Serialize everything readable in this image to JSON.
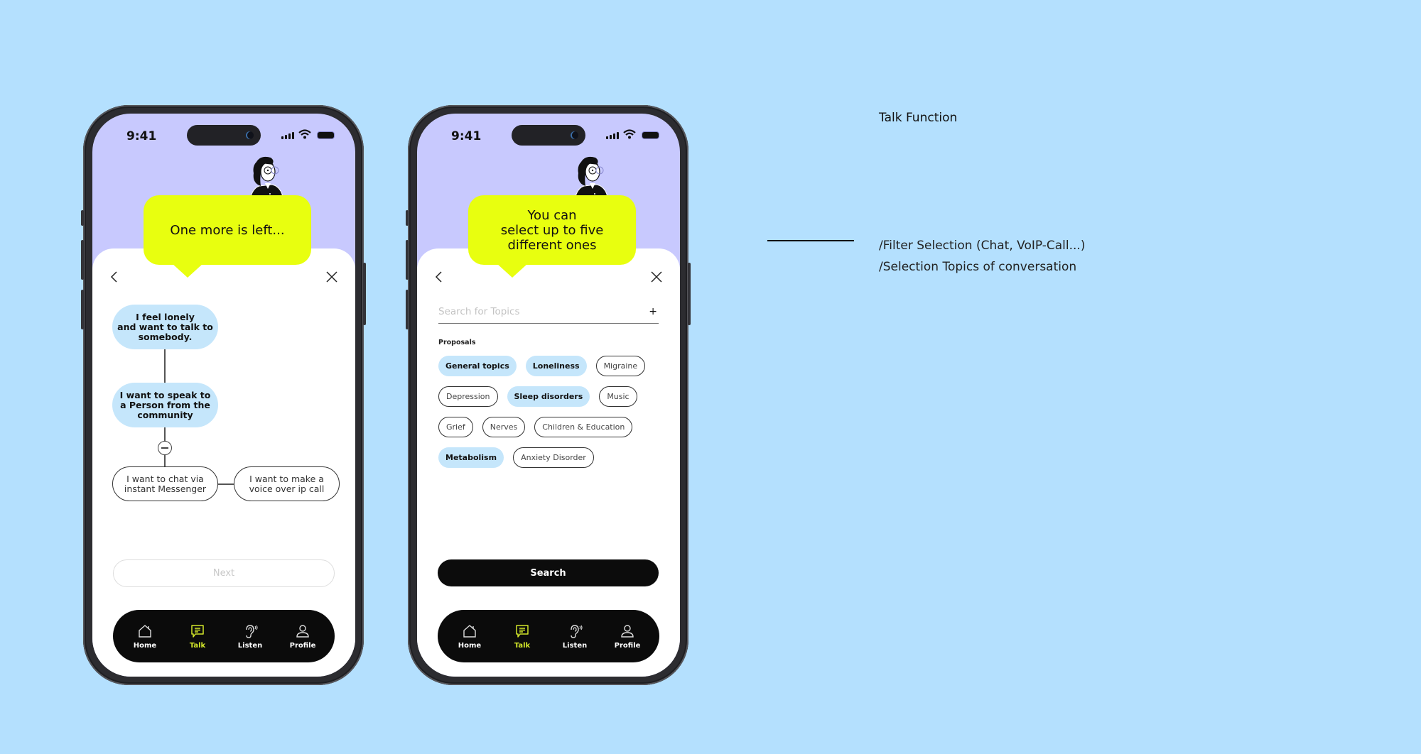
{
  "annotation": {
    "title": "Talk Function",
    "items": [
      "/Filter Selection (Chat, VoIP-Call...)",
      "/Selection Topics of conversation"
    ]
  },
  "colors": {
    "background": "#b4e0fe",
    "header_lavender": "#c8c9fe",
    "bubble_yellow": "#e8ff0f",
    "chip_selected": "#c5e6fb",
    "tab_active": "#d2e62a"
  },
  "phones": [
    {
      "status": {
        "time": "9:41"
      },
      "bubble_text": "One more is left...",
      "flow": {
        "node1": "I feel lonely\nand want to talk to\nsomebody.",
        "node2": "I want to speak to\na  Person from the\ncommunity",
        "option_chat": "I want to chat via\ninstant Messenger",
        "option_voip": "I want to make a\nvoice over ip call"
      },
      "next_label": "Next",
      "tabs": [
        {
          "label": "Home",
          "icon": "home-icon"
        },
        {
          "label": "Talk",
          "icon": "chat-icon",
          "active": true
        },
        {
          "label": "Listen",
          "icon": "ear-icon"
        },
        {
          "label": "Profile",
          "icon": "user-icon"
        }
      ]
    },
    {
      "status": {
        "time": "9:41"
      },
      "bubble_text": "You can\nselect up to five\ndifferent ones",
      "search": {
        "placeholder": "Search for Topics",
        "value": ""
      },
      "proposals_label": "Proposals",
      "chips": [
        [
          {
            "label": "General topics",
            "selected": true
          },
          {
            "label": "Loneliness",
            "selected": true
          },
          {
            "label": "Migraine",
            "selected": false
          }
        ],
        [
          {
            "label": "Depression",
            "selected": false
          },
          {
            "label": "Sleep disorders",
            "selected": true
          },
          {
            "label": "Music",
            "selected": false
          }
        ],
        [
          {
            "label": "Grief",
            "selected": false
          },
          {
            "label": "Nerves",
            "selected": false
          },
          {
            "label": "Children & Education",
            "selected": false
          }
        ],
        [
          {
            "label": "Metabolism",
            "selected": true
          },
          {
            "label": "Anxiety Disorder",
            "selected": false
          }
        ]
      ],
      "search_button_label": "Search",
      "tabs": [
        {
          "label": "Home",
          "icon": "home-icon"
        },
        {
          "label": "Talk",
          "icon": "chat-icon",
          "active": true
        },
        {
          "label": "Listen",
          "icon": "ear-icon"
        },
        {
          "label": "Profile",
          "icon": "user-icon"
        }
      ]
    }
  ]
}
